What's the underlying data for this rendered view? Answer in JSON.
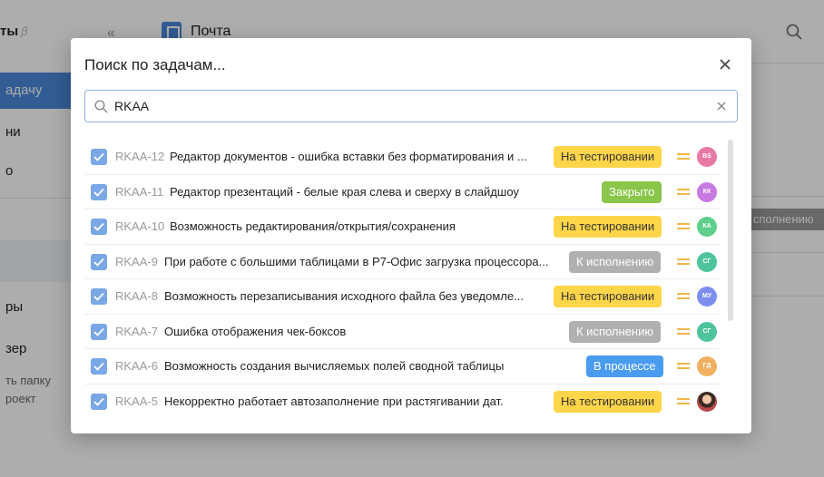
{
  "app": {
    "sidebar_title": "ты",
    "sidebar_title_beta": "β",
    "sidebar_primary_button": "адачу",
    "sidebar_items": [
      "ни",
      "о",
      "ры",
      "зер"
    ],
    "sidebar_small_items": [
      "ть папку",
      "роект"
    ],
    "collapse_icon": "«",
    "page_title": "Почта",
    "status_pill": "сполнению"
  },
  "modal": {
    "title": "Поиск по задачам...",
    "search": {
      "value": "RKAA",
      "placeholder": ""
    }
  },
  "tasks": [
    {
      "id": "RKAA-12",
      "title": "Редактор документов - ошибка вставки без форматирования и ...",
      "status": "На тестировании",
      "status_kind": "testing",
      "assignee": "ВS",
      "avatar_color": "#e879a6"
    },
    {
      "id": "RKAA-11",
      "title": "Редактор презентаций - белые края слева и сверху в слайдшоу",
      "status": "Закрыто",
      "status_kind": "closed",
      "assignee": "КК",
      "avatar_color": "#c77ae0"
    },
    {
      "id": "RKAA-10",
      "title": "Возможность редактирования/открытия/сохранения",
      "status": "На тестировании",
      "status_kind": "testing",
      "assignee": "КА",
      "avatar_color": "#5fcf8c"
    },
    {
      "id": "RKAA-9",
      "title": "При работе с большими таблицами в Р7-Офис загрузка процессора...",
      "status": "К исполнению",
      "status_kind": "todo",
      "assignee": "СГ",
      "avatar_color": "#4ec49a"
    },
    {
      "id": "RKAA-8",
      "title": "Возможность перезаписывания исходного файла без уведомле...",
      "status": "На тестировании",
      "status_kind": "testing",
      "assignee": "МУ",
      "avatar_color": "#7e8ef0"
    },
    {
      "id": "RKAA-7",
      "title": "Ошибка отображения чек-боксов",
      "status": "К исполнению",
      "status_kind": "todo",
      "assignee": "СГ",
      "avatar_color": "#4ec49a"
    },
    {
      "id": "RKAA-6",
      "title": "Возможность создания вычисляемых полей сводной таблицы",
      "status": "В процессе",
      "status_kind": "progress",
      "assignee": "ГД",
      "avatar_color": "#f0b060"
    },
    {
      "id": "RKAA-5",
      "title": "Некорректно работает автозаполнение при растягивании дат.",
      "status": "На тестировании",
      "status_kind": "testing",
      "assignee": "",
      "avatar_color": "photo"
    }
  ],
  "colors": {
    "accent": "#4a88d9",
    "checkbox": "#7aa7e6",
    "status_testing": "#ffd54a",
    "status_closed": "#8ac64a",
    "status_todo": "#b0b0b0",
    "status_progress": "#4a9cf0",
    "priority_medium": "#f0b84a"
  },
  "icons": {
    "top_search": "search-icon",
    "close": "close-icon",
    "search_field": "search-icon",
    "clear": "clear-icon",
    "checkbox": "check-icon",
    "priority": "priority-medium-icon"
  }
}
